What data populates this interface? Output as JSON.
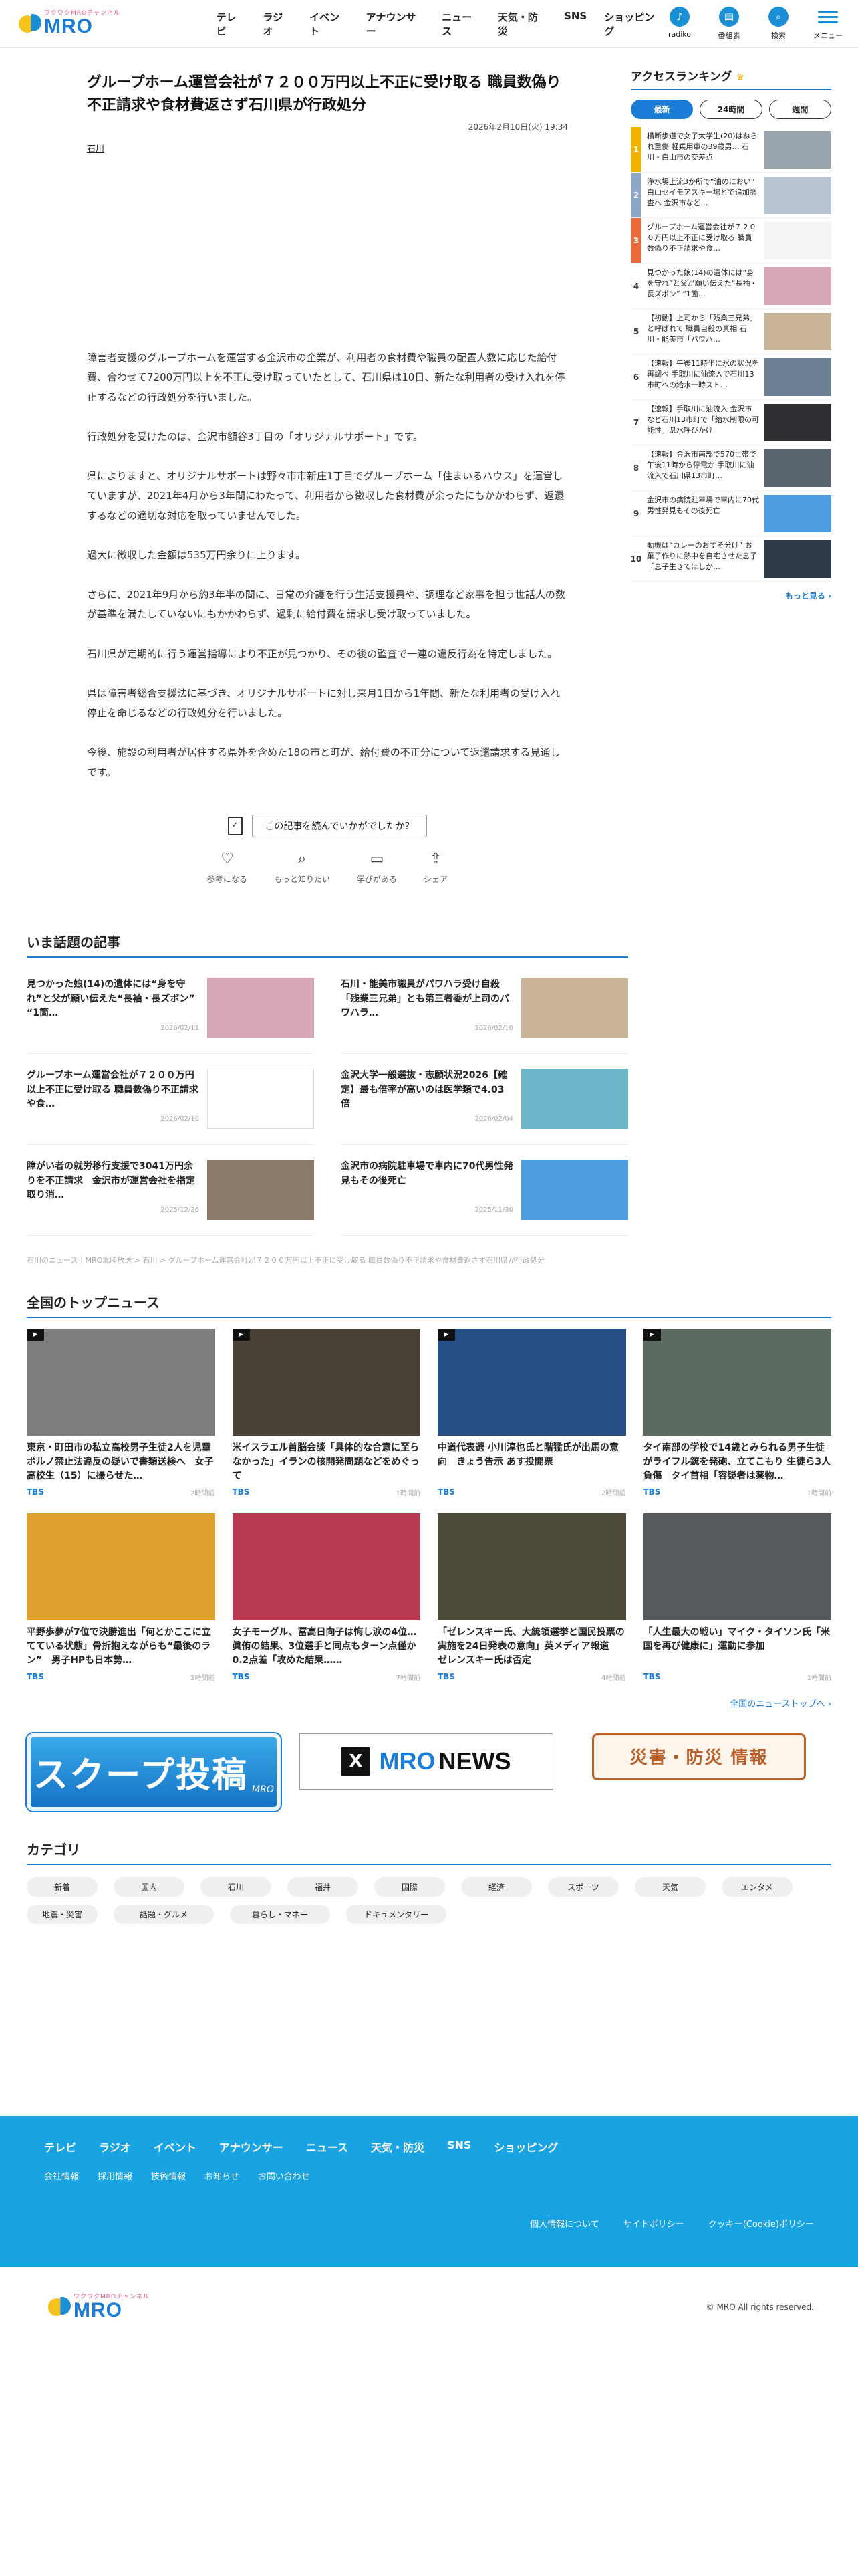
{
  "header": {
    "logo_small": "ワクワクMROチャンネル",
    "logo_big": "MRO",
    "nav": [
      "テレビ",
      "ラジオ",
      "イベント",
      "アナウンサー",
      "ニュース",
      "天気・防災",
      "SNS",
      "ショッピング"
    ],
    "icons": [
      {
        "label": "radiko",
        "icon": "radio-icon",
        "glyph": "♪"
      },
      {
        "label": "番組表",
        "icon": "schedule-icon",
        "glyph": "▤"
      },
      {
        "label": "検索",
        "icon": "search-icon",
        "glyph": "⌕"
      },
      {
        "label": "メニュー",
        "icon": "menu-icon",
        "glyph": ""
      }
    ]
  },
  "article": {
    "title": "グループホーム運営会社が７２００万円以上不正に受け取る 職員数偽り不正請求や食材費返さず石川県が行政処分",
    "date": "2026年2月10日(火) 19:34",
    "category": "石川",
    "paragraphs": [
      "障害者支援のグループホームを運営する金沢市の企業が、利用者の食材費や職員の配置人数に応じた給付費、合わせて7200万円以上を不正に受け取っていたとして、石川県は10日、新たな利用者の受け入れを停止するなどの行政処分を行いました。",
      "行政処分を受けたのは、金沢市額谷3丁目の「オリジナルサポート」です。",
      "県によりますと、オリジナルサポートは野々市市新庄1丁目でグループホーム「住まいるハウス」を運営していますが、2021年4月から3年間にわたって、利用者から徴収した食材費が余ったにもかかわらず、返還するなどの適切な対応を取っていませんでした。",
      "過大に徴収した金額は535万円余りに上ります。",
      "さらに、2021年9月から約3年半の間に、日常の介護を行う生活支援員や、調理など家事を担う世話人の数が基準を満たしていないにもかかわらず、過剰に給付費を請求し受け取っていました。",
      "石川県が定期的に行う運営指導により不正が見つかり、その後の監査で一連の違反行為を特定しました。",
      "県は障害者総合支援法に基づき、オリジナルサポートに対し来月1日から1年間、新たな利用者の受け入れ停止を命じるなどの行政処分を行いました。",
      "今後、施設の利用者が居住する県外を含めた18の市と町が、給付費の不正分について返還請求する見通しです。"
    ]
  },
  "feedback": {
    "question": "この記事を読んでいかがでしたか？",
    "actions": [
      {
        "label": "参考になる",
        "icon": "lightbulb-icon",
        "glyph": "♡"
      },
      {
        "label": "もっと知りたい",
        "icon": "magnifier-icon",
        "glyph": "⌕"
      },
      {
        "label": "学びがある",
        "icon": "book-icon",
        "glyph": "▭"
      },
      {
        "label": "シェア",
        "icon": "share-icon",
        "glyph": "⇪"
      }
    ]
  },
  "topics": {
    "title": "いま話題の記事",
    "items": [
      {
        "title": "見つかった娘(14)の遺体には“身を守れ”と父が願い伝えた“長袖・長ズボン” “1箇…",
        "date": "2026/02/11",
        "thumb": "#d8a8b6"
      },
      {
        "title": "石川・能美市職員がパワハラ受け自殺「残業三兄弟」とも第三者委が上司のパワハラ…",
        "date": "2026/02/10",
        "thumb": "#c9b49a"
      },
      {
        "title": "グループホーム運営会社が７２００万円以上不正に受け取る 職員数偽り不正請求や食…",
        "date": "2026/02/10",
        "thumb": "#ffffff"
      },
      {
        "title": "金沢大学一般選抜・志願状況2026【確定】最も倍率が高いのは医学類で4.03倍",
        "date": "2026/02/04",
        "thumb": "#6bb7c9"
      },
      {
        "title": "障がい者の就労移行支援で3041万円余りを不正請求　金沢市が運営会社を指定取り消…",
        "date": "2025/12/26",
        "thumb": "#8a7a6a"
      },
      {
        "title": "金沢市の病院駐車場で車内に70代男性発見もその後死亡",
        "date": "2025/11/30",
        "thumb": "#4d9be0"
      }
    ]
  },
  "breadcrumb": "石川のニュース｜MRO北陸放送 > 石川 > グループホーム運営会社が７２００万円以上不正に受け取る 職員数偽り不正請求や食材費返さず石川県が行政処分",
  "ranking": {
    "title": "アクセスランキング",
    "tabs": [
      "最新",
      "24時間",
      "週間"
    ],
    "items": [
      {
        "no": "1",
        "title": "横断歩道で女子大学生(20)はねられ重傷 軽乗用車の39歳男… 石川・白山市の交差点",
        "thumb": "#9aa4ad"
      },
      {
        "no": "2",
        "title": "浄水場上流3か所で“油のにおい” 白山セイモアスキー場どで追加調査へ 金沢市など…",
        "thumb": "#b8c4cf"
      },
      {
        "no": "3",
        "title": "グループホーム運営会社が７２００万円以上不正に受け取る 職員数偽り不正請求や食…",
        "thumb": "#f4f4f4"
      },
      {
        "no": "4",
        "title": "見つかった娘(14)の遺体には“身を守れ”と父が願い伝えた“長袖・長ズボン” “1箇…",
        "thumb": "#d8a8b6"
      },
      {
        "no": "5",
        "title": "【初動】上司から「残業三兄弟」と呼ばれて 職員自殺の真相 石川・能美市「パワハ…",
        "thumb": "#c9b49a"
      },
      {
        "no": "6",
        "title": "【速報】午後11時半に氷の状況を再調べ 手取川に油流入で石川13市町への給水一時スト…",
        "thumb": "#6a7f92"
      },
      {
        "no": "7",
        "title": "【速報】手取川に油流入 金沢市など石川13市町で「給水制限の可能性」県水呼びかけ",
        "thumb": "#2e2e33"
      },
      {
        "no": "8",
        "title": "【速報】金沢市南部で570世帯で午後11時から停電か 手取川に油流入で石川県13市町…",
        "thumb": "#59646e"
      },
      {
        "no": "9",
        "title": "金沢市の病院駐車場で車内に70代男性発見もその後死亡",
        "thumb": "#4d9be0"
      },
      {
        "no": "10",
        "title": "動機は“カレーのおすそ分け” お菓子作りに熱中を自宅させた息子「息子生きてほしか…",
        "thumb": "#2f3a48"
      }
    ],
    "more": "もっと見る"
  },
  "national": {
    "title": "全国のトップニュース",
    "items": [
      {
        "title": "東京・町田市の私立高校男子生徒2人を児童ポルノ禁止法違反の疑いで書類送検へ　女子高校生（15）に撮らせた…",
        "source": "TBS",
        "time": "2時間前",
        "thumb": "#7d7d7d",
        "video": true
      },
      {
        "title": "米イスラエル首脳会談「具体的な合意に至らなかった」イランの核開発問題などをめぐって",
        "source": "TBS",
        "time": "1時間前",
        "thumb": "#4a4236",
        "video": true
      },
      {
        "title": "中道代表選 小川淳也氏と階猛氏が出馬の意向　きょう告示 あす投開票",
        "source": "TBS",
        "time": "2時間前",
        "thumb": "#274f86",
        "video": true
      },
      {
        "title": "タイ南部の学校で14歳とみられる男子生徒がライフル銃を発砲、立てこもり 生徒ら3人負傷　タイ首相「容疑者は薬物…",
        "source": "TBS",
        "time": "1時間前",
        "thumb": "#5b6b5f",
        "video": true
      },
      {
        "title": "平野歩夢が7位で決勝進出「何とかここに立てている状態」骨折抱えながらも“最後のラン”　男子HPも日本勢…",
        "source": "TBS",
        "time": "2時間前",
        "thumb": "#e0a030",
        "video": false
      },
      {
        "title": "女子モーグル、冨高日向子は悔し涙の4位…眞侑の結果、3位選手と同点もターン点僅か0.2点差「攻めた結果……",
        "source": "TBS",
        "time": "7時間前",
        "thumb": "#b63a52",
        "video": false
      },
      {
        "title": "「ゼレンスキー氏、大統領選挙と国民投票の実施を24日発表の意向」英メディア報道　ゼレンスキー氏は否定",
        "source": "TBS",
        "time": "4時間前",
        "thumb": "#4e4a3a",
        "video": false
      },
      {
        "title": "「人生最大の戦い」マイク・タイソン氏「米国を再び健康に」運動に参加",
        "source": "TBS",
        "time": "1時間前",
        "thumb": "#56595e",
        "video": false
      }
    ],
    "more": "全国のニューストップへ"
  },
  "banners": {
    "scoop": "スクープ投稿",
    "scoop_sub": "MRO",
    "mro": "MRO",
    "news": "NEWS",
    "x": "X",
    "disaster": "災害・防災 情報"
  },
  "categories": {
    "title": "カテゴリ",
    "items": [
      "新着",
      "国内",
      "石川",
      "福井",
      "国際",
      "経済",
      "スポーツ",
      "天気",
      "エンタメ",
      "地震・災害",
      "話題・グルメ",
      "暮らし・マネー",
      "ドキュメンタリー"
    ]
  },
  "footer": {
    "nav": [
      "テレビ",
      "ラジオ",
      "イベント",
      "アナウンサー",
      "ニュース",
      "天気・防災",
      "SNS",
      "ショッピング"
    ],
    "sub": [
      "会社情報",
      "採用情報",
      "技術情報",
      "お知らせ",
      "お問い合わせ"
    ],
    "legal": [
      "個人情報について",
      "サイトポリシー",
      "クッキー(Cookie)ポリシー"
    ],
    "copyright": "© MRO All rights reserved."
  }
}
